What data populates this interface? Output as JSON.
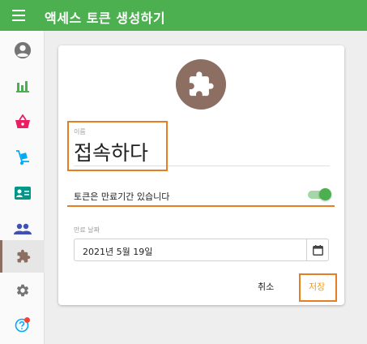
{
  "app": {
    "title": "액세스 토큰 생성하기"
  },
  "colors": {
    "primary": "#4caf50",
    "accent": "#e67e22",
    "avatar": "#8d6e63",
    "save": "#f39c12"
  },
  "sidebar": {
    "items": [
      {
        "icon": "account-circle-icon",
        "color": "#757575"
      },
      {
        "icon": "bar-chart-icon",
        "color": "#4caf50"
      },
      {
        "icon": "shopping-basket-icon",
        "color": "#e91e63"
      },
      {
        "icon": "dolly-icon",
        "color": "#03a9f4"
      },
      {
        "icon": "contact-card-icon",
        "color": "#009688"
      },
      {
        "icon": "people-icon",
        "color": "#3f51b5"
      },
      {
        "icon": "puzzle-icon",
        "color": "#8d6e63",
        "active": true
      },
      {
        "icon": "gear-icon",
        "color": "#757575"
      },
      {
        "icon": "help-icon",
        "color": "#03a9f4",
        "badge": true
      }
    ]
  },
  "form": {
    "avatar_icon": "puzzle-icon",
    "name_label": "이름",
    "name_value": "접속하다",
    "expire_toggle_label": "토큰은 만료기간 있습니다",
    "expire_toggle_on": true,
    "date_label": "만료 날짜",
    "date_value": "2021년 5월 19일",
    "calendar_icon": "calendar-icon",
    "cancel_label": "취소",
    "save_label": "저장"
  }
}
